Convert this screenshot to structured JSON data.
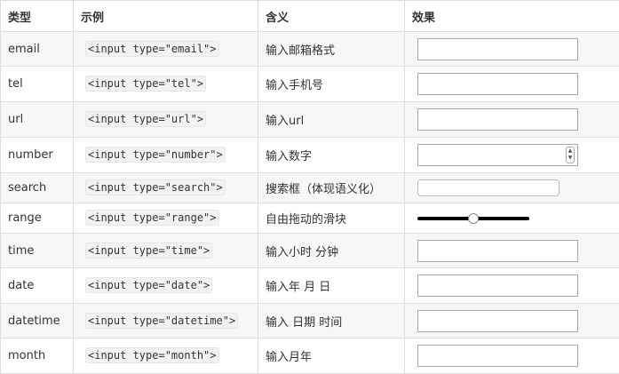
{
  "headers": {
    "type": "类型",
    "example": "示例",
    "meaning": "含义",
    "effect": "效果"
  },
  "rows": [
    {
      "type": "email",
      "code": "<input type=\"email\">",
      "meaning": "输入邮箱格式"
    },
    {
      "type": "tel",
      "code": "<input type=\"tel\">",
      "meaning": "输入手机号"
    },
    {
      "type": "url",
      "code": "<input type=\"url\">",
      "meaning": "输入url"
    },
    {
      "type": "number",
      "code": "<input type=\"number\">",
      "meaning": "输入数字"
    },
    {
      "type": "search",
      "code": "<input type=\"search\">",
      "meaning": "搜索框（体现语义化）"
    },
    {
      "type": "range",
      "code": "<input type=\"range\">",
      "meaning": "自由拖动的滑块",
      "value": 0.5
    },
    {
      "type": "time",
      "code": "<input type=\"time\">",
      "meaning": "输入小时 分钟"
    },
    {
      "type": "date",
      "code": "<input type=\"date\">",
      "meaning": "输入年 月 日"
    },
    {
      "type": "datetime",
      "code": "<input type=\"datetime\">",
      "meaning": "输入 日期 时间"
    },
    {
      "type": "month",
      "code": "<input type=\"month\">",
      "meaning": "输入月年"
    }
  ],
  "colors": {
    "row_alt": "#f7f7f7",
    "border": "#dddddd",
    "track": "#000000"
  },
  "icons": {
    "spinner": "number-spinner-icon"
  }
}
